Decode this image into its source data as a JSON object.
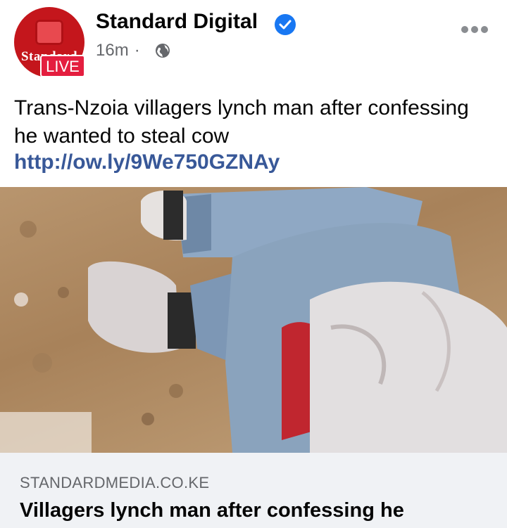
{
  "post": {
    "page_name": "Standard Digital",
    "avatar_wordmark": "Standard",
    "live_label": "LIVE",
    "time": "16m",
    "audience_icon": "globe-icon",
    "verified_icon": "verified-badge-icon",
    "more_icon": "more-options-icon",
    "text": "Trans-Nzoia villagers lynch man after confessing he wanted to steal cow",
    "link": "http://ow.ly/9We750GZNAy"
  },
  "link_preview": {
    "domain": "STANDARDMEDIA.CO.KE",
    "title": "Villagers lynch man after confessing he"
  },
  "colors": {
    "brand_red": "#c4161c",
    "live_red": "#e41e3f",
    "verified_blue": "#1877f2",
    "link_blue": "#385898",
    "card_bg": "#f0f2f5"
  }
}
